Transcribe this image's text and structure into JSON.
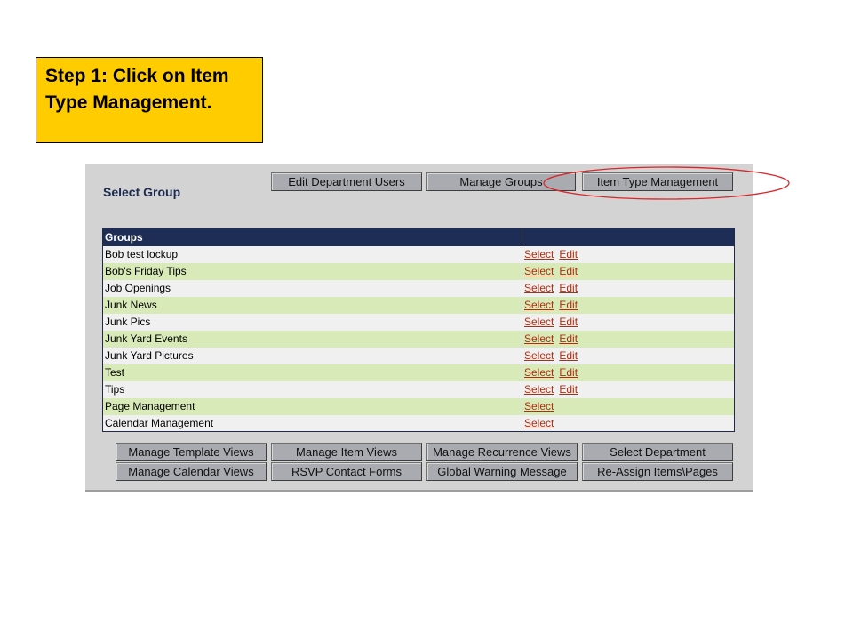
{
  "callout": {
    "text": "Step 1: Click on Item Type Management."
  },
  "panel": {
    "title": "Select Group"
  },
  "top_buttons": [
    "Edit Department Users",
    "Manage Groups",
    "Item Type Management"
  ],
  "table": {
    "header": "Groups",
    "rows": [
      {
        "name": "Bob test lockup",
        "actions": [
          "Select",
          "Edit"
        ]
      },
      {
        "name": "Bob's Friday Tips",
        "actions": [
          "Select",
          "Edit"
        ]
      },
      {
        "name": "Job Openings",
        "actions": [
          "Select",
          "Edit"
        ]
      },
      {
        "name": "Junk News",
        "actions": [
          "Select",
          "Edit"
        ]
      },
      {
        "name": "Junk Pics",
        "actions": [
          "Select",
          "Edit"
        ]
      },
      {
        "name": "Junk Yard Events",
        "actions": [
          "Select",
          "Edit"
        ]
      },
      {
        "name": "Junk Yard Pictures",
        "actions": [
          "Select",
          "Edit"
        ]
      },
      {
        "name": "Test",
        "actions": [
          "Select",
          "Edit"
        ]
      },
      {
        "name": "Tips",
        "actions": [
          "Select",
          "Edit"
        ]
      },
      {
        "name": "Page Management",
        "actions": [
          "Select"
        ]
      },
      {
        "name": "Calendar Management",
        "actions": [
          "Select"
        ]
      }
    ]
  },
  "bottom_buttons": [
    [
      "Manage Template Views",
      "Manage Item Views",
      "Manage Recurrence Views",
      "Select Department"
    ],
    [
      "Manage Calendar Views",
      "RSVP Contact Forms",
      "Global Warning Message",
      "Re-Assign Items\\Pages"
    ]
  ],
  "colors": {
    "callout": "#ffcc00",
    "header": "#1e2d55",
    "row_alt": "#d8eab7",
    "highlight_ellipse": "#d9262a"
  }
}
